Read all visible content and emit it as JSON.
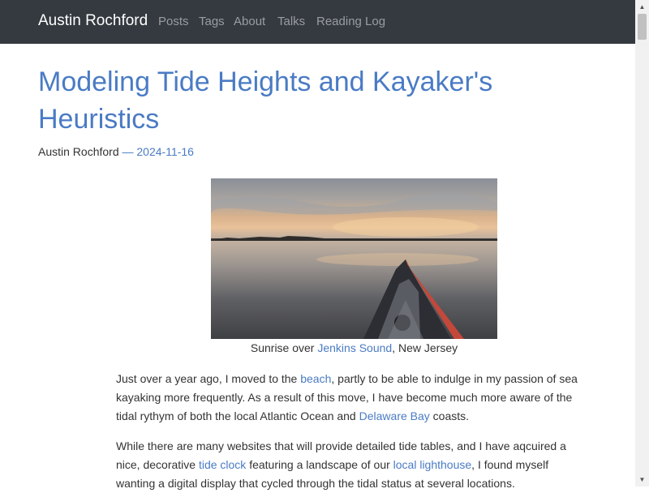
{
  "navbar": {
    "brand": "Austin Rochford",
    "links": [
      "Posts",
      "Tags",
      "About",
      "Talks",
      "Reading Log"
    ]
  },
  "post": {
    "title": "Modeling Tide Heights and Kayaker's Heuristics",
    "author": "Austin Rochford",
    "separator": " — ",
    "date": "2024-11-16",
    "figure": {
      "caption_prefix": "Sunrise over ",
      "caption_link": "Jenkins Sound",
      "caption_suffix": ", New Jersey"
    },
    "paragraph1": {
      "text1": "Just over a year ago, I moved to the ",
      "link1": "beach",
      "text2": ", partly to be able to indulge in my passion of sea kayaking more frequently. As a result of this move, I have become much more aware of the tidal rythym of both the local Atlantic Ocean and ",
      "link2": "Delaware Bay",
      "text3": " coasts."
    },
    "paragraph2": {
      "text1": "While there are many websites that will provide detailed tide tables, and I have aqcuired a nice, decorative ",
      "link1": "tide clock",
      "text2": " featuring a landscape of our ",
      "link2": "local lighthouse",
      "text3": ", I found myself wanting a digital display that cycled through the tidal status at several locations."
    }
  },
  "colors": {
    "navbar_bg": "#343a40",
    "link": "#4a7bc4",
    "nav_link": "#9a9da1"
  }
}
